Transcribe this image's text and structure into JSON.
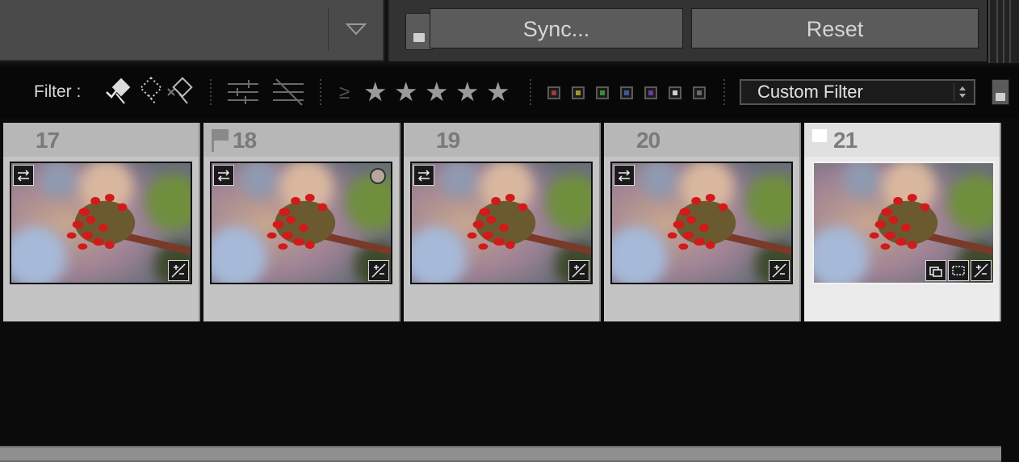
{
  "top_toolbar": {
    "sync_label": "Sync...",
    "reset_label": "Reset"
  },
  "filter_bar": {
    "label": "Filter :",
    "rating_operator": "≥",
    "rating_stars": 5,
    "color_labels": [
      "#a43a3a",
      "#9a9a2a",
      "#3a8a3a",
      "#3a5a9a",
      "#6a3a9a",
      "#cfcfcf",
      "#6a6a6a"
    ],
    "preset_value": "Custom Filter"
  },
  "filmstrip": {
    "cells": [
      {
        "index": "17",
        "flag": "none",
        "selected": false,
        "badges": [
          "develop-adjust"
        ]
      },
      {
        "index": "18",
        "flag": "flagged",
        "selected": false,
        "badges": [
          "develop-adjust"
        ],
        "circle_badge": true
      },
      {
        "index": "19",
        "flag": "none",
        "selected": false,
        "badges": [
          "develop-adjust"
        ]
      },
      {
        "index": "20",
        "flag": "none",
        "selected": false,
        "badges": [
          "develop-adjust"
        ]
      },
      {
        "index": "21",
        "flag": "white",
        "selected": true,
        "badges": [
          "collection",
          "crop",
          "develop-adjust"
        ]
      }
    ]
  },
  "colors": {
    "background": "#0b0b0b",
    "panel": "#333333",
    "cell": "#c4c4c4",
    "selected_cell": "#eaeaea"
  }
}
